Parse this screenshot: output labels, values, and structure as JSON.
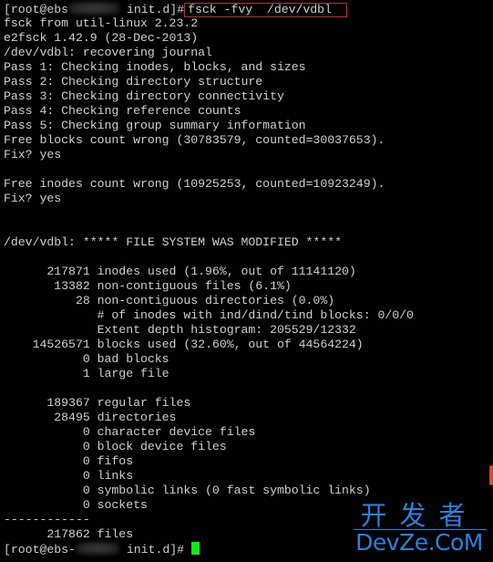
{
  "terminal": {
    "prompt_start": "[root@ebs",
    "prompt_dir": " init.d]#",
    "command": "fsck -fvy  /dev/vdbl",
    "lines": [
      "fsck from util-linux 2.23.2",
      "e2fsck 1.42.9 (28-Dec-2013)",
      "/dev/vdbl: recovering journal",
      "Pass 1: Checking inodes, blocks, and sizes",
      "Pass 2: Checking directory structure",
      "Pass 3: Checking directory connectivity",
      "Pass 4: Checking reference counts",
      "Pass 5: Checking group summary information",
      "Free blocks count wrong (30783579, counted=30037653).",
      "Fix? yes",
      "",
      "Free inodes count wrong (10925253, counted=10923249).",
      "Fix? yes",
      "",
      "",
      "/dev/vdbl: ***** FILE SYSTEM WAS MODIFIED *****",
      "",
      "      217871 inodes used (1.96%, out of 11141120)",
      "       13382 non-contiguous files (6.1%)",
      "          28 non-contiguous directories (0.0%)",
      "             # of inodes with ind/dind/tind blocks: 0/0/0",
      "             Extent depth histogram: 205529/12332",
      "    14526571 blocks used (32.60%, out of 44564224)",
      "           0 bad blocks",
      "           1 large file",
      "",
      "      189367 regular files",
      "       28495 directories",
      "           0 character device files",
      "           0 block device files",
      "           0 fifos",
      "           0 links",
      "           0 symbolic links (0 fast symbolic links)",
      "           0 sockets",
      "------------",
      "      217862 files"
    ],
    "final_prompt_start": "[root@ebs-",
    "final_prompt_dir": " init.d]# "
  },
  "colors": {
    "background": "#020202",
    "text": "#cfcfcf",
    "cursor": "#17e51a",
    "highlight_box": "#b03838",
    "watermark": "#2f7fd8"
  },
  "watermark": {
    "chinese": "开发者",
    "english": "DevZe.CoM"
  }
}
